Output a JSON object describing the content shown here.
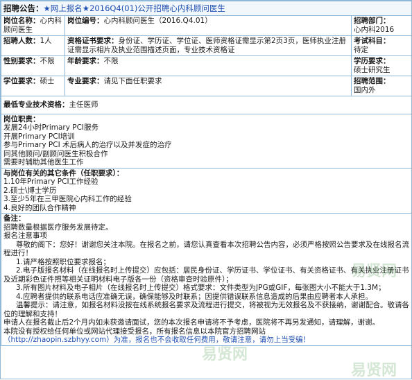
{
  "header": {
    "label": "招聘公告：",
    "title": "★网上报名★2016Q4(01)公开招聘心内科顾问医生"
  },
  "row1": {
    "position_name_label": "岗位名称：",
    "position_name_value": "心内科顾问医生",
    "position_code_label": "岗位编号：",
    "position_code_value": "心内科顾问医生（2016.Q4.01）",
    "dept_label": "招聘部门：",
    "dept_value": "心内科2016"
  },
  "row2": {
    "count_label": "招聘人数：",
    "count_value": "1人",
    "cert_label": "资格证书要求：",
    "cert_value": "身份证、学历证、学位证、医师资格证需显示第2页3页，医师执业注册证需显示相片及执业范围描述页面，专业技术资格证",
    "exam_label": "考试科目：",
    "exam_value": "待定"
  },
  "row3": {
    "gender_label": "性别要求：",
    "gender_value": "不限",
    "age_label": "年龄要求：",
    "age_value": "不限",
    "edu_label": "学历要求：",
    "edu_value": "硕士研究生"
  },
  "row4": {
    "degree_label": "学位要求：",
    "degree_value": "硕士",
    "major_label": "专业要求：",
    "major_value": "请见下面任职要求",
    "scope_label": "招聘范围：",
    "scope_value": "国内外"
  },
  "row5": {
    "title_label": "最低专业技术资格：",
    "title_value": "主任医师"
  },
  "duties": {
    "label": "岗位职责：",
    "items": [
      "发展24小时Primary PCI服务",
      "开展Primary PCI培训",
      "参与Primary PCI 术后病人的治疗以及并发症的治疗",
      "同其他顾问/副顾问医生积极合作",
      "需要时辅助其他医生工作"
    ]
  },
  "conditions": {
    "label": "与岗位有关的其它条件（任职要求）：",
    "items": [
      "1.10年Primary PCI工作经验",
      "2.硕士\\博士学历",
      "3.至少5年在三甲医院心内科工作的经验",
      "4.良好的团队合作精神"
    ]
  },
  "notes": {
    "label": "备注：",
    "lines": [
      "招聘数量根据医疗服务发展待定。",
      "报名注意事项",
      "尊敬的阁下：您好！谢谢您关注本院。在报名之前，请您认真查看本次招聘公告内容，必须严格按照公告要求及在线报名流程进行！",
      "1.请严格按照职位要求报名；",
      "2.电子版报名材料（在线报名时上传提交）应包括：居民身份证、学历证书、学位证书、有关资格证书、有关执业注册证书及近期彩色证件照等相关证明材料电子版各一份（资格审查时验原件）；",
      "3.所有图片材料及电子相片（在线报名时上传提交）格式要求：文件类型为JPG或GIF，每张图大小不能大于1.3M；",
      "4.应聘者提供的联系电话应准确无误，确保能够及时联系；因提供错误联系信息造成的后果由应聘者本人承担。",
      "温馨提示：请注意，如报名材料没按在线系统报名要求及流程进行提交，将被视为无效报名及不获接纳，谢谢配合。敬请各位的理解和支持！",
      "申请人在报名截止后2个月内如未获邀请面试，您的本次报名申请将不予考虑，医院将不再另发通知，请理解，谢谢。",
      "本院没有授权给任何单位或网站代理接受报名，所有报名信息以本院官方招聘网站",
      "（http://zhaopin.szbhyy.com）为准，报名也不会收取任何费用，敬请注意，请勿上当受骗！"
    ]
  },
  "watermarks": [
    "易贤网",
    "易贤网",
    "易贤网"
  ]
}
